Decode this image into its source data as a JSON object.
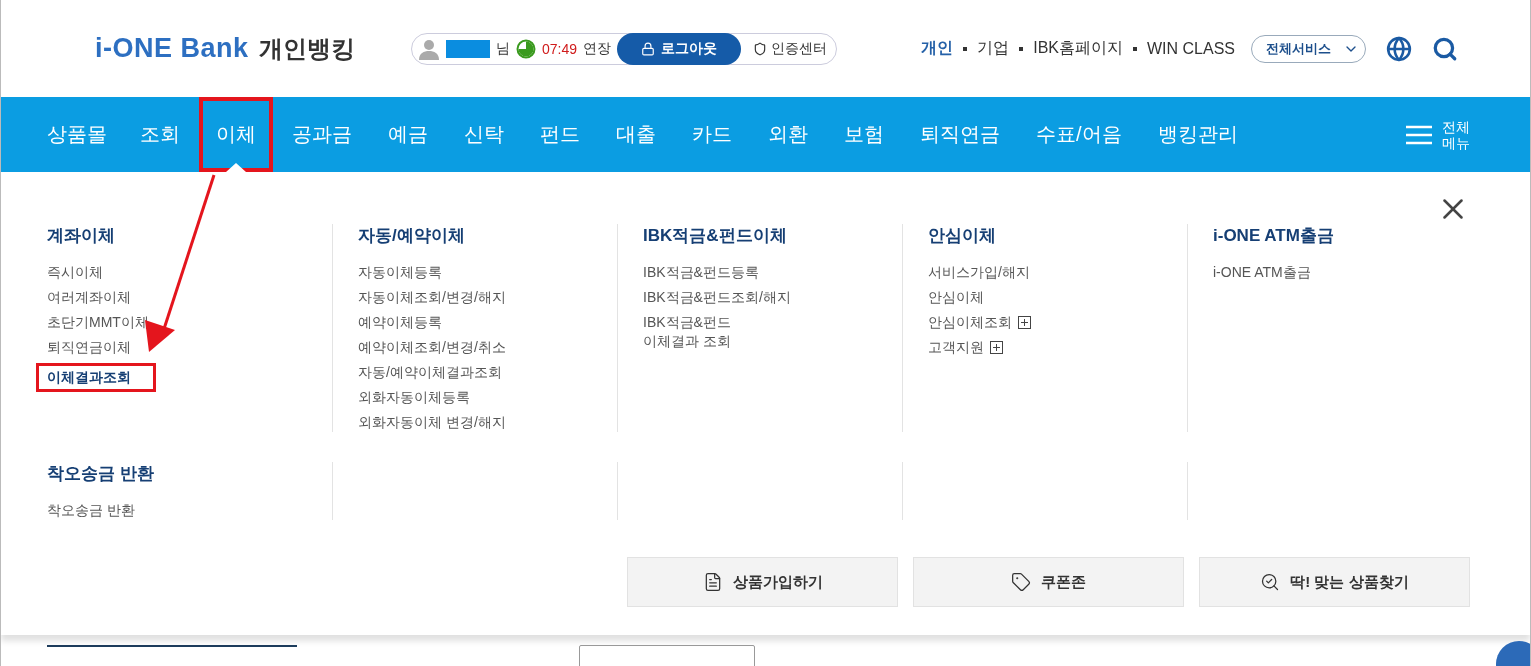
{
  "header": {
    "logo": {
      "brand": "i-ONE Bank",
      "service": "개인뱅킹"
    },
    "session": {
      "suffix": "님",
      "timer": "07:49",
      "extend": "연장",
      "logout": "로그아웃",
      "certificate": "인증센터"
    },
    "links": [
      {
        "label": "개인",
        "selected": true
      },
      {
        "label": "기업",
        "selected": false
      },
      {
        "label": "IBK홈페이지",
        "selected": false
      },
      {
        "label": "WIN CLASS",
        "selected": false
      }
    ],
    "all_services": "전체서비스"
  },
  "nav": {
    "items": [
      {
        "label": "상품몰",
        "selected": false,
        "highlighted": false
      },
      {
        "label": "조회",
        "selected": false,
        "highlighted": false
      },
      {
        "label": "이체",
        "selected": true,
        "highlighted": true
      },
      {
        "label": "공과금",
        "selected": false,
        "highlighted": false
      },
      {
        "label": "예금",
        "selected": false,
        "highlighted": false
      },
      {
        "label": "신탁",
        "selected": false,
        "highlighted": false
      },
      {
        "label": "펀드",
        "selected": false,
        "highlighted": false
      },
      {
        "label": "대출",
        "selected": false,
        "highlighted": false
      },
      {
        "label": "카드",
        "selected": false,
        "highlighted": false
      },
      {
        "label": "외환",
        "selected": false,
        "highlighted": false
      },
      {
        "label": "보험",
        "selected": false,
        "highlighted": false
      },
      {
        "label": "퇴직연금",
        "selected": false,
        "highlighted": false
      },
      {
        "label": "수표/어음",
        "selected": false,
        "highlighted": false
      },
      {
        "label": "뱅킹관리",
        "selected": false,
        "highlighted": false
      }
    ],
    "all_menu": "전체\n메뉴"
  },
  "menu": {
    "groups": [
      {
        "title": "계좌이체",
        "items": [
          {
            "label": "즉시이체",
            "highlighted": false,
            "expandable": false
          },
          {
            "label": "여러계좌이체",
            "highlighted": false,
            "expandable": false
          },
          {
            "label": "초단기MMT이체",
            "highlighted": false,
            "expandable": false
          },
          {
            "label": "퇴직연금이체",
            "highlighted": false,
            "expandable": false
          },
          {
            "label": "이체결과조회",
            "highlighted": true,
            "expandable": false
          }
        ]
      },
      {
        "title": "자동/예약이체",
        "items": [
          {
            "label": "자동이체등록",
            "highlighted": false,
            "expandable": false
          },
          {
            "label": "자동이체조회/변경/해지",
            "highlighted": false,
            "expandable": false
          },
          {
            "label": "예약이체등록",
            "highlighted": false,
            "expandable": false
          },
          {
            "label": "예약이체조회/변경/취소",
            "highlighted": false,
            "expandable": false
          },
          {
            "label": "자동/예약이체결과조회",
            "highlighted": false,
            "expandable": false
          },
          {
            "label": "외화자동이체등록",
            "highlighted": false,
            "expandable": false
          },
          {
            "label": "외화자동이체 변경/해지",
            "highlighted": false,
            "expandable": false
          }
        ]
      },
      {
        "title": "IBK적금&펀드이체",
        "items": [
          {
            "label": "IBK적금&펀드등록",
            "highlighted": false,
            "expandable": false
          },
          {
            "label": "IBK적금&펀드조회/해지",
            "highlighted": false,
            "expandable": false
          },
          {
            "label": "IBK적금&펀드\n이체결과 조회",
            "highlighted": false,
            "expandable": false
          }
        ]
      },
      {
        "title": "안심이체",
        "items": [
          {
            "label": "서비스가입/해지",
            "highlighted": false,
            "expandable": false
          },
          {
            "label": "안심이체",
            "highlighted": false,
            "expandable": false
          },
          {
            "label": "안심이체조회",
            "highlighted": false,
            "expandable": true
          },
          {
            "label": "고객지원",
            "highlighted": false,
            "expandable": true
          }
        ]
      },
      {
        "title": "i-ONE ATM출금",
        "items": [
          {
            "label": "i-ONE ATM출금",
            "highlighted": false,
            "expandable": false
          }
        ]
      },
      {
        "title": "착오송금 반환",
        "items": [
          {
            "label": "착오송금 반환",
            "highlighted": false,
            "expandable": false
          }
        ]
      }
    ],
    "buttons": [
      {
        "label": "상품가입하기",
        "kind": "document"
      },
      {
        "label": "쿠폰존",
        "kind": "coupon"
      },
      {
        "label": "딱! 맞는 상품찾기",
        "kind": "search"
      }
    ]
  }
}
